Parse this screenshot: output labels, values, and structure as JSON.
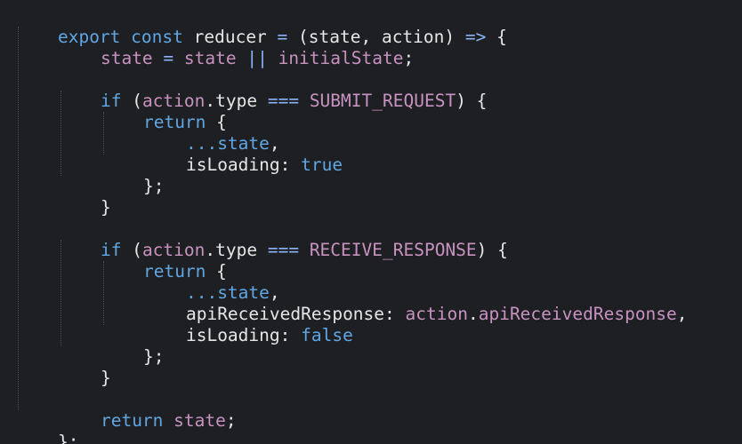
{
  "code": {
    "l1": {
      "export": "export",
      "const": "const",
      "name": " reducer ",
      "eq": "=",
      "params": " (state, action) ",
      "arrow": "=>",
      "brace": " {"
    },
    "l2": {
      "state": "state",
      "eq": " = ",
      "state2": "state",
      "or": " || ",
      "init": "initialState",
      "semi": ";"
    },
    "l4": {
      "if": "if",
      "open": " (",
      "action": "action",
      "dot": ".",
      "type": "type ",
      "eqeq": "===",
      "const": " SUBMIT_REQUEST",
      "close": ") {"
    },
    "l5": {
      "return": "return",
      "brace": " {"
    },
    "l6": {
      "spread": "...state",
      "comma": ","
    },
    "l7": {
      "key": "isLoading:",
      "val": " true"
    },
    "l8": {
      "text": "};"
    },
    "l9": {
      "text": "}"
    },
    "l11": {
      "if": "if",
      "open": " (",
      "action": "action",
      "dot": ".",
      "type": "type ",
      "eqeq": "===",
      "const": " RECEIVE_RESPONSE",
      "close": ") {"
    },
    "l12": {
      "return": "return",
      "brace": " {"
    },
    "l13": {
      "spread": "...state",
      "comma": ","
    },
    "l14": {
      "key": "apiReceivedResponse:",
      "obj": " action",
      "dot": ".",
      "prop": "apiReceivedResponse",
      "comma": ","
    },
    "l15": {
      "key": "isLoading:",
      "val": " false"
    },
    "l16": {
      "text": "};"
    },
    "l17": {
      "text": "}"
    },
    "l19": {
      "return": "return",
      "state": " state",
      "semi": ";"
    },
    "l20": {
      "text": "};"
    }
  },
  "colors": {
    "background": "#1e1f22",
    "keyword": "#5fa6e3",
    "variable": "#c792c0",
    "text": "#e6e6e6"
  }
}
